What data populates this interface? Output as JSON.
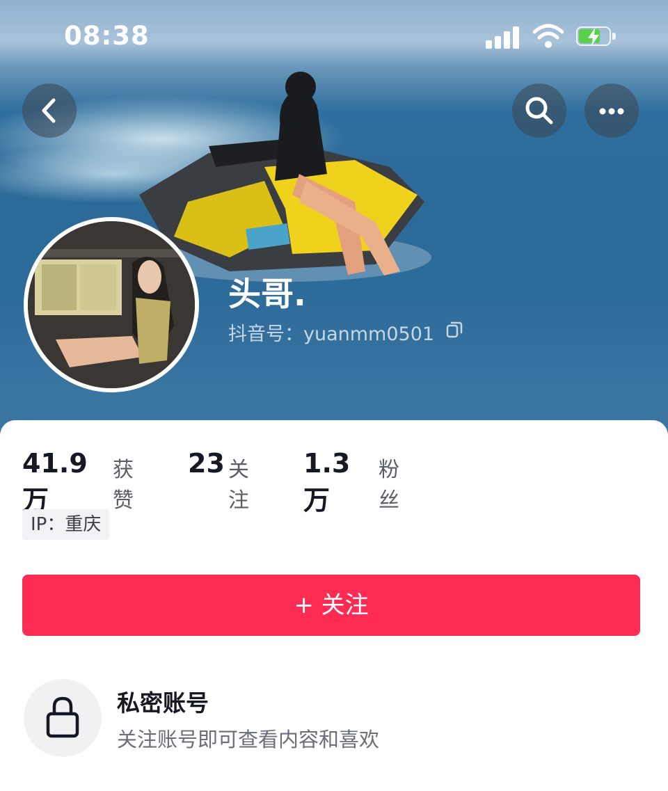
{
  "status_bar": {
    "time": "08:38",
    "icons": [
      "signal-icon",
      "wifi-icon",
      "battery-charging-icon"
    ],
    "battery_color": "#59d04a"
  },
  "nav": {
    "back_icon": "chevron-left-icon",
    "search_icon": "search-icon",
    "more_icon": "more-dots-icon"
  },
  "profile": {
    "username": "头哥.",
    "douyin_id": "抖音号：yuanmm0501",
    "copy_icon": "copy-icon"
  },
  "stats": {
    "likes_value": "41.9万",
    "likes_label": "获赞",
    "following_value": "23",
    "following_label": "关注",
    "followers_value": "1.3万",
    "followers_label": "粉丝"
  },
  "ip": {
    "label": "IP：重庆"
  },
  "follow_button": {
    "label": "+ 关注",
    "color": "#fe2c55"
  },
  "private": {
    "icon": "lock-icon",
    "title": "私密账号",
    "description": "关注账号即可查看内容和喜欢"
  }
}
